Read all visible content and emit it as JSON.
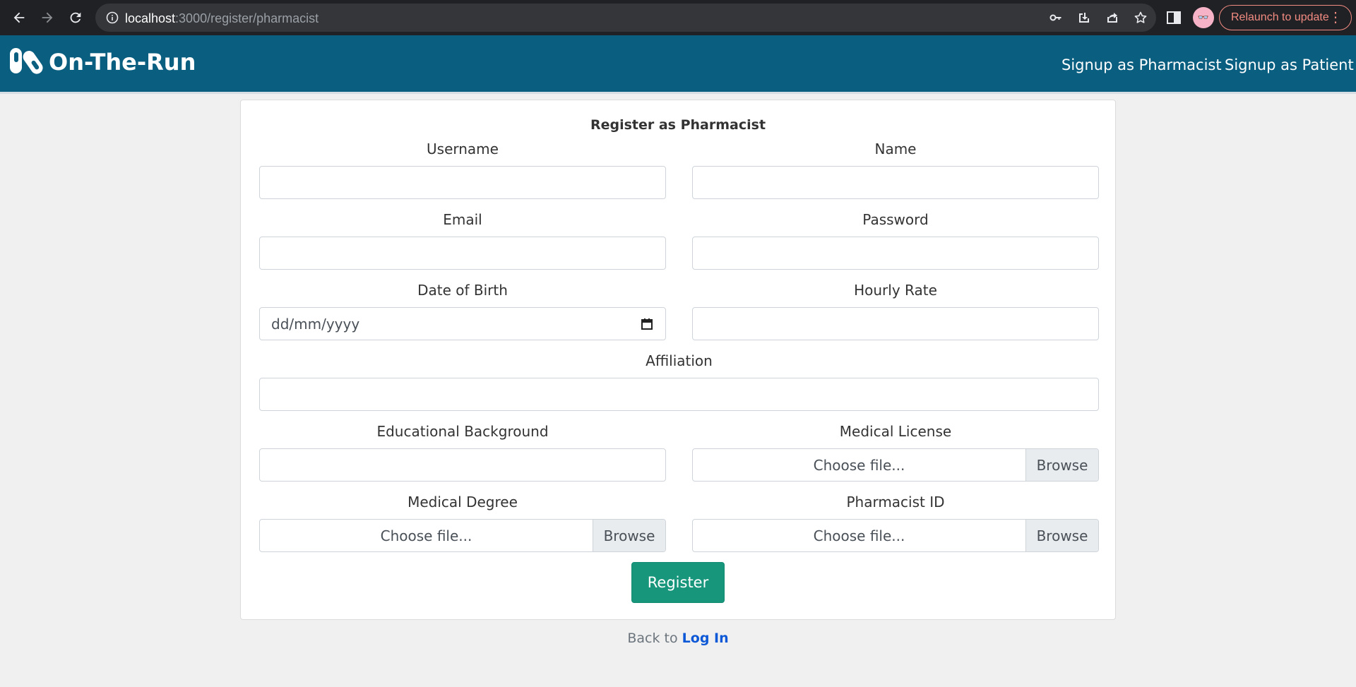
{
  "browser": {
    "url_host": "localhost",
    "url_path": ":3000/register/pharmacist",
    "profile_glyph": "👓",
    "relaunch_label": "Relaunch to update",
    "menu_glyph": "⋮"
  },
  "header": {
    "brand": "On-The-Run",
    "links": [
      "Signup as Pharmacist",
      "Signup as Patient"
    ]
  },
  "form": {
    "title": "Register as Pharmacist",
    "labels": {
      "username": "Username",
      "name": "Name",
      "email": "Email",
      "password": "Password",
      "dob": "Date of Birth",
      "hourly_rate": "Hourly Rate",
      "affiliation": "Affiliation",
      "education": "Educational Background",
      "medical_license": "Medical License",
      "medical_degree": "Medical Degree",
      "pharmacist_id": "Pharmacist ID"
    },
    "values": {
      "username": "",
      "name": "",
      "email": "",
      "password": "",
      "hourly_rate": "",
      "affiliation": "",
      "education": ""
    },
    "date_placeholder": "dd/mm/yyyy",
    "file_placeholder": "Choose file...",
    "browse_label": "Browse",
    "submit_label": "Register"
  },
  "footer": {
    "back_text": "Back to",
    "login_link": "Log In"
  },
  "colors": {
    "header_bg": "#0a5e80",
    "register_button": "#17967c",
    "link": "#0d58d6"
  },
  "icons": [
    "back-arrow-icon",
    "forward-arrow-icon",
    "reload-icon",
    "info-icon",
    "key-icon",
    "install-icon",
    "share-icon",
    "star-icon",
    "sidebar-icon",
    "calendar-icon",
    "pill-logo-icon"
  ]
}
